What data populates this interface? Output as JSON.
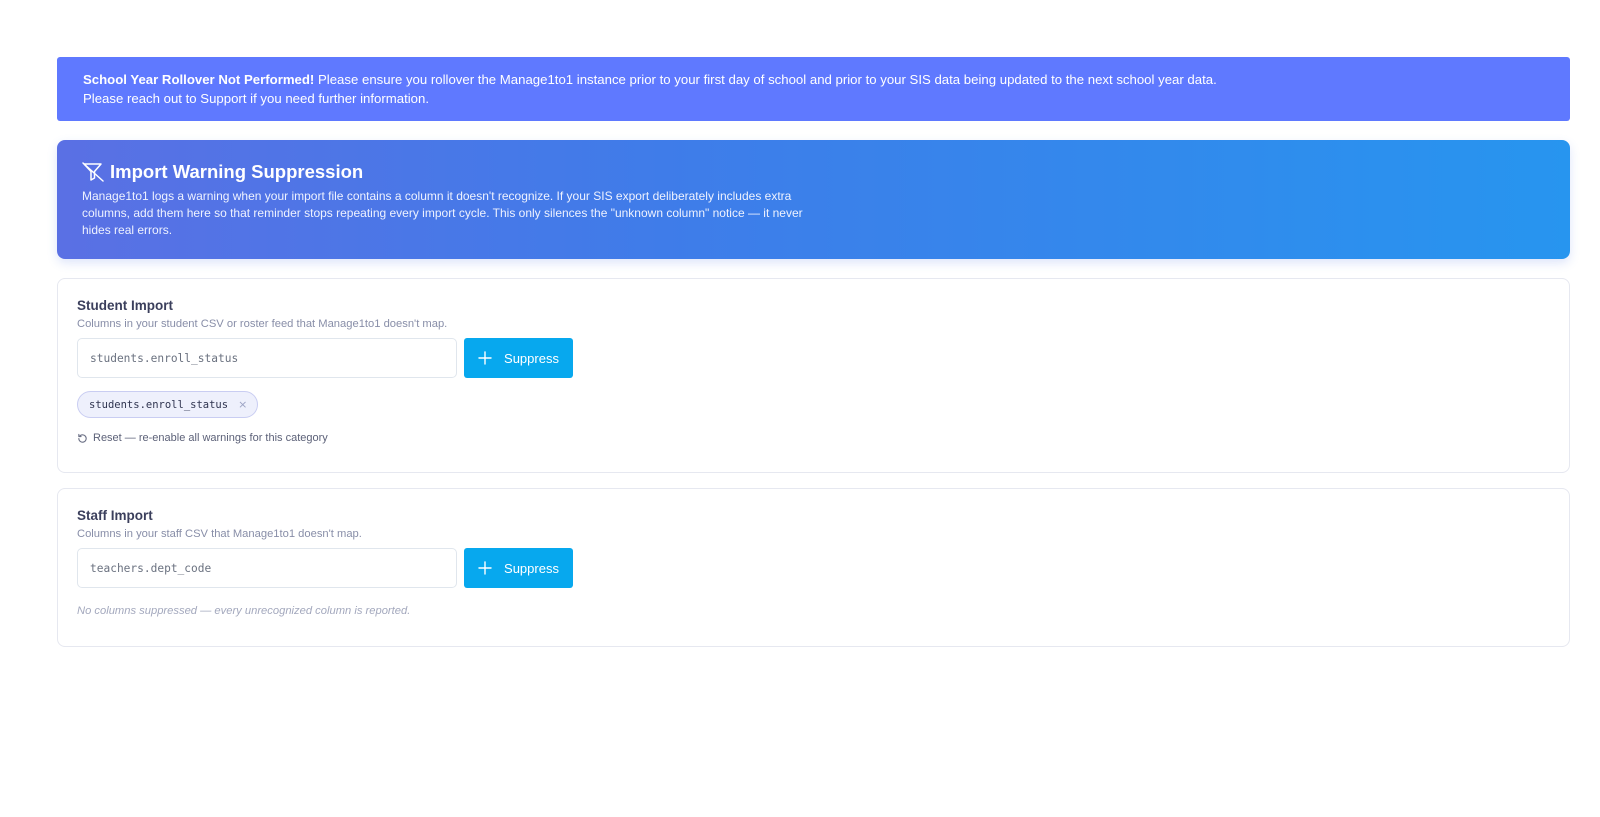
{
  "alert": {
    "title": "School Year Rollover Not Performed!",
    "line1": " Please ensure you rollover the Manage1to1 instance prior to your first day of school and prior to your SIS data being updated to the next school year data.",
    "line2": "Please reach out to Support if you need further information."
  },
  "hero": {
    "icon": "filter-off-icon",
    "title": "Import Warning Suppression",
    "description": "Manage1to1 logs a warning when your import file contains a column it doesn't recognize. If your SIS export deliberately includes extra columns, add them here so that reminder stops repeating every import cycle. This only silences the \"unknown column\" notice — it never hides real errors."
  },
  "student": {
    "title": "Student Import",
    "subtitle": "Columns in your student CSV or roster feed that Manage1to1 doesn't map.",
    "input_placeholder": "students.enroll_status",
    "button_label": "Suppress",
    "chips": [
      "students.enroll_status"
    ],
    "chip_remove": "×",
    "reset_label": "Reset — re-enable all warnings for this category"
  },
  "staff": {
    "title": "Staff Import",
    "subtitle": "Columns in your staff CSV that Manage1to1 doesn't map.",
    "input_placeholder": "teachers.dept_code",
    "button_label": "Suppress",
    "empty_text": "No columns suppressed — every unrecognized column is reported."
  },
  "colors": {
    "alert": "#5f79ff",
    "hero_start": "#5a70e4",
    "hero_end": "#2795ef",
    "button": "#07a8ee"
  }
}
